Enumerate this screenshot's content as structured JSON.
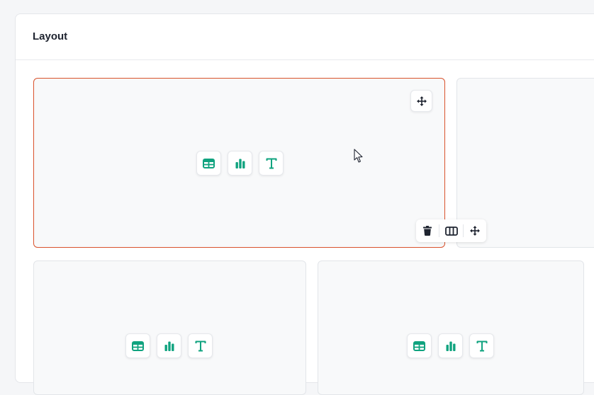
{
  "panel": {
    "title": "Layout"
  },
  "colors": {
    "accent": "#10a37f",
    "selected_border": "#d9522c",
    "icon_dark": "#1f2430"
  },
  "cells": [
    {
      "id": "top-left",
      "selected": true,
      "widget_options": [
        "table-icon",
        "bar-chart-icon",
        "text-icon"
      ]
    },
    {
      "id": "top-right",
      "selected": false
    },
    {
      "id": "bottom-left",
      "selected": false,
      "widget_options": [
        "table-icon",
        "bar-chart-icon",
        "text-icon"
      ]
    },
    {
      "id": "bottom-right",
      "selected": false,
      "widget_options": [
        "table-icon",
        "bar-chart-icon",
        "text-icon"
      ]
    }
  ],
  "selected_toolbar": {
    "buttons": [
      "trash-icon",
      "columns-icon",
      "move-icon"
    ]
  }
}
